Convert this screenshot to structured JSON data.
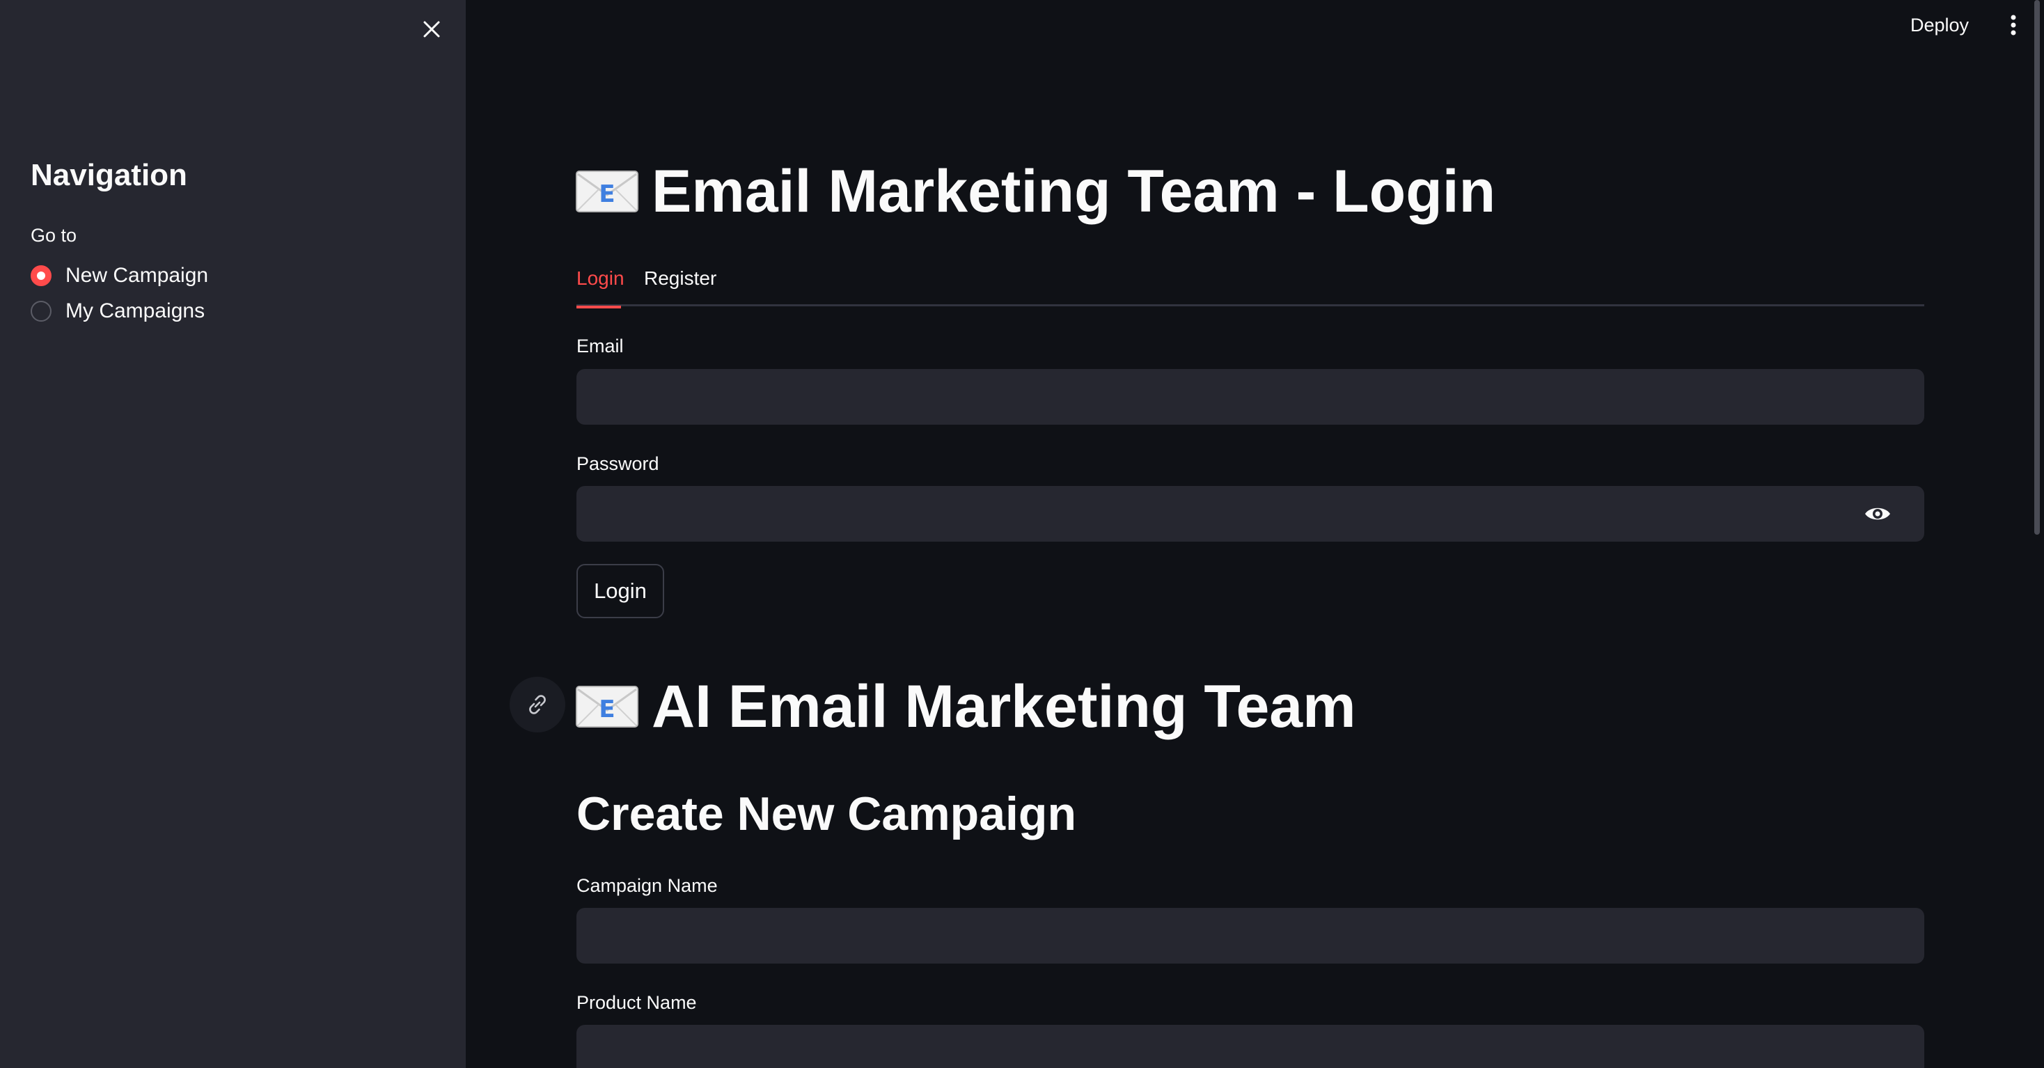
{
  "sidebar": {
    "close_icon": "close-icon",
    "title": "Navigation",
    "radio_label": "Go to",
    "options": [
      {
        "label": "New Campaign",
        "selected": true
      },
      {
        "label": "My Campaigns",
        "selected": false
      }
    ]
  },
  "header": {
    "deploy_label": "Deploy",
    "menu_icon": "vertical-ellipsis-icon"
  },
  "login": {
    "title": "Email Marketing Team - Login",
    "tabs": [
      {
        "label": "Login",
        "active": true
      },
      {
        "label": "Register",
        "active": false
      }
    ],
    "email_label": "Email",
    "email_value": "",
    "password_label": "Password",
    "password_value": "",
    "show_password_icon": "eye-icon",
    "submit_label": "Login"
  },
  "app": {
    "title": "AI Email Marketing Team",
    "anchor_icon": "link-icon",
    "section_title": "Create New Campaign",
    "campaign_name_label": "Campaign Name",
    "campaign_name_value": "",
    "product_name_label": "Product Name",
    "product_name_value": ""
  },
  "colors": {
    "accent": "#ff4b4b",
    "background": "#0f1116",
    "sidebar": "#262730",
    "input": "#262730"
  }
}
